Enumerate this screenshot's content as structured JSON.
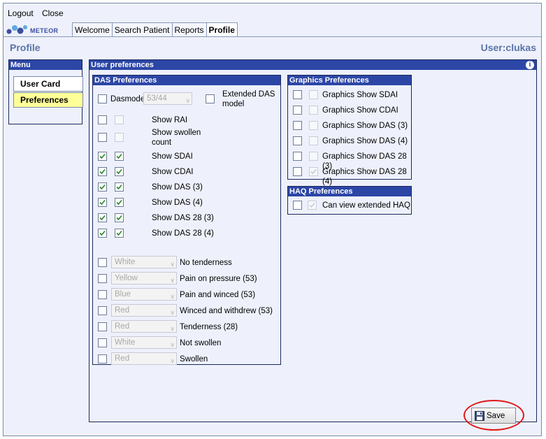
{
  "top": {
    "logout": "Logout",
    "close": "Close"
  },
  "brand": {
    "name": "METEOR"
  },
  "tabs": [
    "Welcome",
    "Search Patient",
    "Reports",
    "Profile"
  ],
  "page": {
    "title": "Profile",
    "user": "User:clukas"
  },
  "menu": {
    "title": "Menu",
    "items": [
      "User Card",
      "Preferences"
    ],
    "active": "Preferences"
  },
  "prefs": {
    "title": "User preferences"
  },
  "das": {
    "title": "DAS Preferences",
    "dasmodel_label": "Dasmodel",
    "dasmodel_value": "53/44",
    "extended": "Extended DAS model",
    "show_rai": "Show RAI",
    "show_swollen": "Show swollen count",
    "checked": [
      {
        "label": "Show SDAI",
        "a": true,
        "b": true
      },
      {
        "label": "Show CDAI",
        "a": true,
        "b": true
      },
      {
        "label": "Show DAS (3)",
        "a": true,
        "b": true
      },
      {
        "label": "Show DAS (4)",
        "a": true,
        "b": true
      },
      {
        "label": "Show DAS 28 (3)",
        "a": true,
        "b": true
      },
      {
        "label": "Show DAS 28 (4)",
        "a": true,
        "b": true
      }
    ],
    "colors": [
      {
        "color": "White",
        "label": "No tenderness"
      },
      {
        "color": "Yellow",
        "label": "Pain on pressure (53)"
      },
      {
        "color": "Blue",
        "label": "Pain and winced (53)"
      },
      {
        "color": "Red",
        "label": "Winced and withdrew (53)"
      },
      {
        "color": "Red",
        "label": "Tenderness (28)"
      },
      {
        "color": "White",
        "label": "Not swollen"
      },
      {
        "color": "Red",
        "label": "Swollen"
      }
    ]
  },
  "graphics": {
    "title": "Graphics Preferences",
    "items": [
      {
        "label": "Graphics Show SDAI",
        "checked": false
      },
      {
        "label": "Graphics Show CDAI",
        "checked": false
      },
      {
        "label": "Graphics Show DAS (3)",
        "checked": false
      },
      {
        "label": "Graphics Show DAS (4)",
        "checked": false
      },
      {
        "label": "Graphics Show DAS 28 (3)",
        "checked": false
      },
      {
        "label": "Graphics Show DAS 28 (4)",
        "checked": true
      }
    ]
  },
  "haq": {
    "title": "HAQ Preferences",
    "label": "Can view extended HAQ",
    "checked": true
  },
  "save": {
    "label": "Save"
  },
  "colors": {
    "header": "#2c46a6",
    "title": "#5a74a8",
    "active_menu": "#ffff99",
    "highlight": "#e01a1a"
  }
}
